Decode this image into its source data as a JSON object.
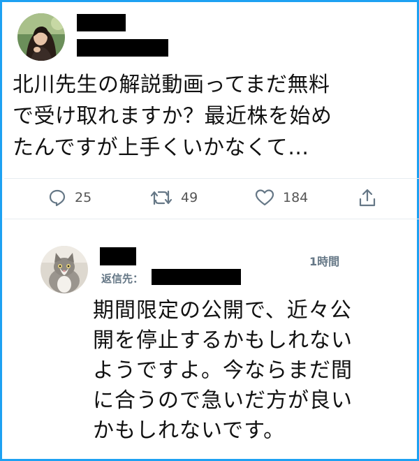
{
  "tweet": {
    "text_lines": [
      "北川先生の解説動画ってまだ無料",
      "で受け取れますか？最近株を始め",
      "たんですが上手くいかなくて…"
    ],
    "actions": {
      "reply_count": "25",
      "retweet_count": "49",
      "like_count": "184"
    }
  },
  "reply": {
    "time": "1時間",
    "reply_to_label": "返信先：",
    "text_lines": [
      "期間限定の公開で、近々公",
      "開を停止するかもしれない",
      "ようですよ。今ならまだ間",
      "に合うので急いだ方が良い",
      "かもしれないです。"
    ]
  },
  "colors": {
    "frame_border": "#1da1f2",
    "icon_gray": "#657786",
    "redaction": "#000000"
  },
  "icons": [
    "reply-icon",
    "retweet-icon",
    "like-icon",
    "share-icon"
  ]
}
